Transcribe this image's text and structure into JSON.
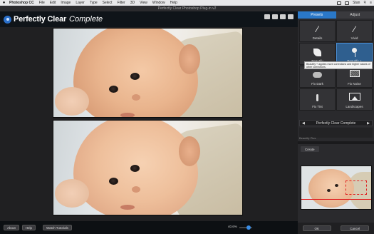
{
  "menubar": {
    "app": "Photoshop CC",
    "items": [
      "File",
      "Edit",
      "Image",
      "Layer",
      "Type",
      "Select",
      "Filter",
      "3D",
      "View",
      "Window",
      "Help"
    ],
    "user": "Stan"
  },
  "window": {
    "title": "Perfectly Clear Photoshop Plug-in v2"
  },
  "header": {
    "brand": "Perfectly Clear",
    "brand_sub": "Complete"
  },
  "panel": {
    "tabs": [
      {
        "label": "Presets",
        "active": true
      },
      {
        "label": "Adjust",
        "active": false
      }
    ],
    "presets": [
      {
        "label": "Details",
        "icon": "wand-icon"
      },
      {
        "label": "Vivid",
        "icon": "brush-icon"
      },
      {
        "label": "Beautify",
        "icon": "leaf-icon"
      },
      {
        "label": "Beautify +",
        "icon": "lollipop-icon",
        "selected": true
      },
      {
        "label": "Fix Dark",
        "icon": "cloud-icon"
      },
      {
        "label": "Fix Noise",
        "icon": "noise-icon"
      },
      {
        "label": "Fix Tint",
        "icon": "thermometer-icon"
      },
      {
        "label": "Landscapes",
        "icon": "landscape-icon"
      }
    ],
    "tooltip": "Beautify + applies more corrections and higher values of other corrections.",
    "selector": {
      "value": "Perfectly Clear Complete",
      "left": "◀",
      "right": "▶"
    },
    "beautify_label": "Beautify Plus",
    "create_tab": "Create",
    "ok": "OK",
    "cancel": "Cancel"
  },
  "footer": {
    "about": "About",
    "help": "Help",
    "watch": "Watch Tutorials",
    "zoom": "40.6%"
  },
  "colors": {
    "accent": "#2a78c8",
    "header_bg": "#0f1419"
  }
}
